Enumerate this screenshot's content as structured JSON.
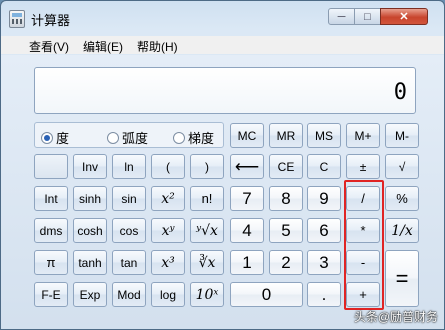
{
  "window": {
    "title": "计算器",
    "min_label": "─",
    "max_label": "□",
    "close_label": "✕"
  },
  "menu": [
    "查看(V)",
    "编辑(E)",
    "帮助(H)"
  ],
  "display": {
    "value": "0"
  },
  "angle_modes": [
    {
      "label": "度",
      "selected": true
    },
    {
      "label": "弧度",
      "selected": false
    },
    {
      "label": "梯度",
      "selected": false
    }
  ],
  "memory_keys": [
    "MC",
    "MR",
    "MS",
    "M+",
    "M-"
  ],
  "row2": [
    "",
    "Inv",
    "ln",
    "(",
    ")",
    "⟵",
    "CE",
    "C",
    "±",
    "√"
  ],
  "row3": [
    "Int",
    "sinh",
    "sin",
    "x²",
    "n!",
    "7",
    "8",
    "9",
    "/",
    "%"
  ],
  "row4": [
    "dms",
    "cosh",
    "cos",
    "xʸ",
    "ʸ√x",
    "4",
    "5",
    "6",
    "*",
    "1/x"
  ],
  "row5": [
    "π",
    "tanh",
    "tan",
    "x³",
    "∛x",
    "1",
    "2",
    "3",
    "-",
    "="
  ],
  "row6": [
    "F-E",
    "Exp",
    "Mod",
    "log",
    "10ˣ",
    "0",
    ".",
    "+"
  ],
  "watermark": "头条@励普财务",
  "colors": {
    "highlight_box": "#e02424",
    "close_button": "#c8452e"
  }
}
